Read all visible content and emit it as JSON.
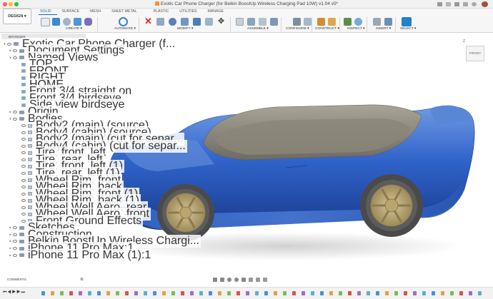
{
  "window": {
    "title": "Exotic Car Phone Charger (for Belkin BoostUp Wireless Charging Pad 10W) v1.04 v5*"
  },
  "toolbar": {
    "workspace": "DESIGN",
    "tabs": [
      "SOLID",
      "SURFACE",
      "MESH",
      "SHEET METAL",
      "PLASTIC",
      "UTILITIES",
      "MANAGE"
    ],
    "groups": [
      "CREATE",
      "AUTOMATE",
      "MODIFY",
      "ASSEMBLE",
      "CONFIGURE",
      "CONSTRUCT",
      "INSPECT",
      "INSERT",
      "SELECT"
    ]
  },
  "browser": {
    "title": "BROWSER",
    "root": "Exotic Car Phone Charger (f...",
    "document_settings": "Document Settings",
    "named_views": "Named Views",
    "views": [
      "TOP",
      "FRONT",
      "RIGHT",
      "HOME",
      "Front 3/4 straight on",
      "Front 3/4 birdseye",
      "Side view birdseye"
    ],
    "origin": "Origin",
    "bodies": "Bodies",
    "body_items": [
      "Body2 (main) (source)",
      "Body4 (cabin) (source)",
      "Body2 (main) (cut for separ...",
      "Body4 (cabin) (cut for separ...",
      "Tire, front, left",
      "Tire, rear, left",
      "Tire, front, left (1)",
      "Tire, rear, left (1)",
      "Wheel Rim, front",
      "Wheel Rim, back",
      "Wheel Rim, front (1)",
      "Wheel Rim, back (1)",
      "Wheel Well Aero, rear",
      "Wheel Well Aero, front",
      "Front Ground Effects"
    ],
    "sketches": "Sketches",
    "construction": "Construction",
    "components": [
      "Belkin BoostUp Wireless Chargi...",
      "iPhone 11 Pro Max:1",
      "iPhone 11 Pro Max (1):1"
    ]
  },
  "viewcube": {
    "face": "FRONT",
    "axis": "Z"
  },
  "comments": {
    "label": "COMMENTS"
  },
  "colors": {
    "accent": "#0b69c7",
    "car_body": "#2f62c9",
    "cabin": "#8e8a7f",
    "rim": "#c5b27c",
    "tire": "#4a4a4a"
  }
}
